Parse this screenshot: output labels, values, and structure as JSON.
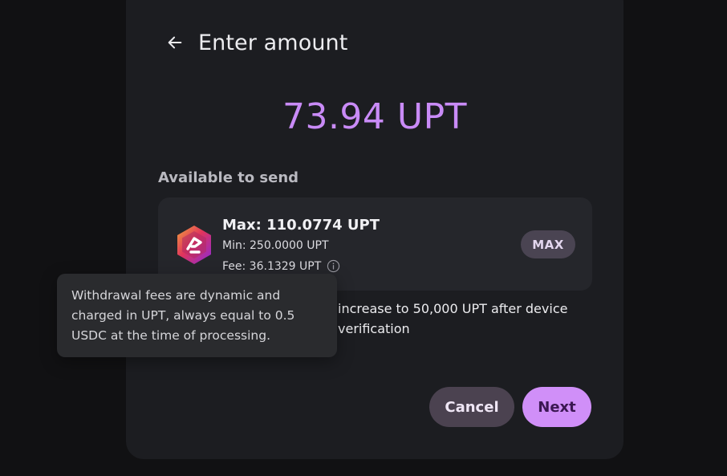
{
  "dialog": {
    "title": "Enter amount",
    "amount_display": "73.94 UPT",
    "available_label": "Available to send"
  },
  "token_card": {
    "max_text": "Max: 110.0774 UPT",
    "min_text": "Min: 250.0000 UPT",
    "fee_text": "Fee: 36.1329 UPT",
    "max_button_label": "MAX"
  },
  "limit_note": "increase to 50,000 UPT after device verification",
  "tooltip": {
    "text": "Withdrawal fees are dynamic and charged in UPT, always equal to 0.5 USDC at the time of processing."
  },
  "actions": {
    "cancel_label": "Cancel",
    "next_label": "Next"
  },
  "colors": {
    "accent": "#c98bf7",
    "next_button": "#d08ff8",
    "cancel_button": "#4b4250",
    "max_button": "#4a4452"
  },
  "icons": {
    "back": "arrow-left-icon",
    "info": "info-icon",
    "token": "upt-token-logo"
  }
}
